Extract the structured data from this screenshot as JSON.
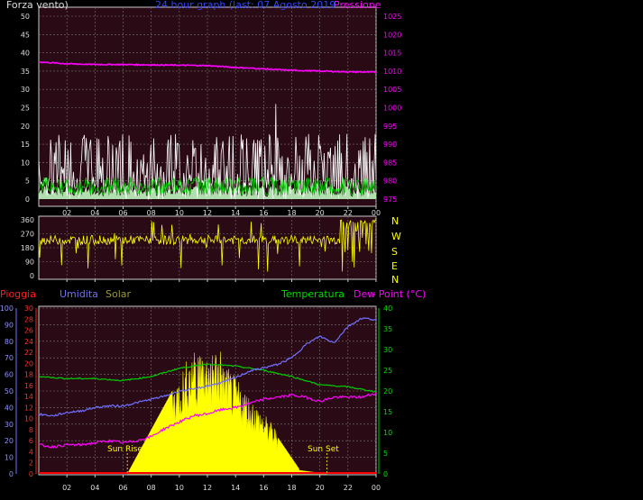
{
  "header": {
    "title_left": "Forza vento)",
    "title_center": "24 hour graph (last: 07 Agosto 2019",
    "title_right": "Pressione"
  },
  "compass": [
    "N",
    "W",
    "S",
    "E",
    "N"
  ],
  "bottom_labels": {
    "rain": "Pioggia",
    "humidity": "Umidita",
    "solar": "Solar",
    "temperature": "Temperatura",
    "dewpoint": "Dew Point (°C)",
    "sunrise": "Sun Rise",
    "sunset": "Sun Set"
  },
  "colors": {
    "panel_bg": "#2a0a14",
    "wind_gust": "#ffffff",
    "wind_avg": "#00cc00",
    "pressure": "#ff00ff",
    "direction": "#ffff00",
    "humidity": "#6f6fff",
    "temperature": "#00cc00",
    "dewpoint": "#ff00ff",
    "solar": "#ffff00",
    "rain": "#ff0000"
  },
  "chart_data": [
    {
      "type": "line",
      "name": "wind-pressure",
      "x_ticks": [
        "02",
        "04",
        "06",
        "08",
        "10",
        "12",
        "14",
        "16",
        "18",
        "20",
        "22",
        "00"
      ],
      "y_left_ticks": [
        0,
        5,
        10,
        15,
        20,
        25,
        30,
        35,
        40,
        45,
        50
      ],
      "y_left_lim": [
        0,
        50
      ],
      "y_right_ticks": [
        975,
        980,
        985,
        990,
        995,
        1000,
        1005,
        1010,
        1015,
        1020,
        1025
      ],
      "y_right_lim": [
        975,
        1025
      ],
      "pressure": {
        "x": [
          0,
          2,
          4,
          6,
          8,
          10,
          12,
          14,
          16,
          18,
          20,
          22,
          24
        ],
        "y": [
          1012.5,
          1012,
          1011.8,
          1011.8,
          1011.7,
          1011.6,
          1011.5,
          1011,
          1010.6,
          1010.2,
          1010,
          1009.8,
          1009.7
        ]
      },
      "wind_gust_peak": 26,
      "wind_typical_range": [
        3,
        18
      ]
    },
    {
      "type": "line",
      "name": "wind-direction",
      "x_ticks": [
        "02",
        "04",
        "06",
        "08",
        "10",
        "12",
        "14",
        "16",
        "18",
        "20",
        "22",
        "00"
      ],
      "y_ticks": [
        0,
        90,
        180,
        270,
        360
      ],
      "y_lim": [
        0,
        360
      ],
      "base_direction": 230
    },
    {
      "type": "line",
      "name": "rain-humidity-solar-temp",
      "x_ticks": [
        "02",
        "04",
        "06",
        "08",
        "10",
        "12",
        "14",
        "16",
        "18",
        "20",
        "22",
        "00"
      ],
      "humidity_ticks": [
        0,
        10,
        20,
        30,
        40,
        50,
        60,
        70,
        80,
        90,
        100
      ],
      "rain_ticks": [
        0,
        2,
        4,
        6,
        8,
        10,
        12,
        14,
        16,
        18,
        20,
        22,
        24,
        26,
        28,
        30
      ],
      "temp_ticks": [
        0,
        5,
        10,
        15,
        20,
        25,
        30,
        35,
        40
      ],
      "humidity": {
        "x": [
          0,
          1,
          2,
          3,
          4,
          5,
          6,
          7,
          8,
          9,
          10,
          11,
          12,
          13,
          14,
          15,
          16,
          17,
          18,
          19,
          20,
          21,
          22,
          23,
          24
        ],
        "y": [
          36,
          35,
          37,
          38,
          40,
          41,
          41,
          43,
          45,
          47,
          50,
          51,
          53,
          55,
          58,
          62,
          64,
          66,
          70,
          78,
          83,
          79,
          89,
          94,
          93
        ]
      },
      "temperature": {
        "x": [
          0,
          2,
          4,
          6,
          8,
          10,
          12,
          14,
          16,
          18,
          20,
          22,
          24
        ],
        "y": [
          23.5,
          23,
          23,
          22.5,
          23.5,
          25.5,
          26.5,
          26,
          25,
          23.5,
          21.5,
          21,
          19.8
        ]
      },
      "dewpoint": {
        "x": [
          0,
          1,
          2,
          3,
          4,
          5,
          6,
          7,
          8,
          9,
          10,
          11,
          12,
          13,
          14,
          15,
          16,
          17,
          18,
          19,
          20,
          21,
          22,
          23,
          24
        ],
        "y": [
          7,
          6.5,
          7,
          7,
          7.5,
          8,
          7.5,
          8,
          9,
          11,
          12.5,
          14,
          14.5,
          15.5,
          16,
          17,
          18,
          18.5,
          19,
          18.5,
          17.5,
          18.5,
          18.5,
          18.5,
          19.5
        ]
      },
      "solar_peak_value": 22,
      "rain": 0
    }
  ]
}
